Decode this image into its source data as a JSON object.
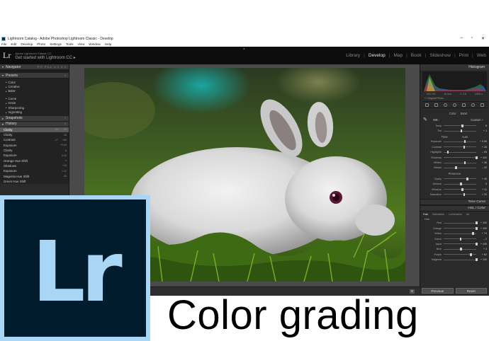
{
  "window": {
    "title": "Lightroom Catalog - Adobe Photoshop Lightroom Classic - Develop",
    "minimize": "–",
    "maximize": "▫",
    "close": "✕"
  },
  "menu": [
    "File",
    "Edit",
    "Develop",
    "Photo",
    "Settings",
    "Tools",
    "View",
    "Window",
    "Help"
  ],
  "identity": {
    "logo": "Lr",
    "subtitle": "Adobe Lightroom Classic CC",
    "main": "Get started with Lightroom CC ▸",
    "modules": [
      "Library",
      "Develop",
      "Map",
      "Book",
      "Slideshow",
      "Print",
      "Web"
    ],
    "active_module": "Develop"
  },
  "left_panel": {
    "navigator": {
      "label": "Navigator",
      "zoom": "FIT  FILL  1:1  3:1"
    },
    "presets": {
      "label": "Presets",
      "groups_a": [
        "Color",
        "Creative",
        "B&W"
      ],
      "groups_b": [
        "Curve",
        "Grain",
        "Sharpening",
        "Vignetting"
      ]
    },
    "snapshots": {
      "label": "Snapshots"
    },
    "history": {
      "label": "History",
      "rows": [
        {
          "name": "Clarity",
          "a": "-46",
          "b": "46",
          "selected": true
        },
        {
          "name": "Clarity",
          "a": "",
          "b": "28"
        },
        {
          "name": "Contrast",
          "a": "-17",
          "b": "+80"
        },
        {
          "name": "Exposure",
          "a": "",
          "b": "+0.60"
        },
        {
          "name": "Clarity",
          "a": "",
          "b": "8"
        },
        {
          "name": "Exposure",
          "a": "",
          "b": "0.43"
        },
        {
          "name": "Orange Hue Shift",
          "a": "",
          "b": "-1"
        },
        {
          "name": "Shadows",
          "a": "",
          "b": "+15"
        },
        {
          "name": "Exposure",
          "a": "",
          "b": "1.12"
        },
        {
          "name": "Magenta Hue Shift",
          "a": "",
          "b": "-40"
        },
        {
          "name": "Green Hue Shift",
          "a": "",
          "b": ""
        }
      ]
    }
  },
  "right_panel": {
    "histogram_label": "Histogram",
    "hist_info": [
      "ISO 100",
      "50 mm",
      "f / 2.8",
      "1/500 s"
    ],
    "original_photo": "Original Photo",
    "basic": {
      "treatment": "Color",
      "profile": "B&W"
    },
    "wb": {
      "label": "WB :",
      "value": "Custom ÷"
    },
    "tone": {
      "label": "Tone",
      "auto": "Auto"
    },
    "presence_label": "Presence",
    "tone_curve_label": "Tone Curve",
    "hsl_label": "HSL / Color",
    "hsl_tabs": [
      "Hue",
      "Saturation",
      "Luminance",
      "All"
    ],
    "hsl_sub": "Hue",
    "sliders": {
      "wb": [
        {
          "label": "Temp",
          "value": "6",
          "pos": 0.55
        },
        {
          "label": "Tint",
          "value": "+ 1",
          "pos": 0.52
        }
      ],
      "tone": [
        {
          "label": "Exposure",
          "value": "+ 0.95",
          "pos": 0.62
        },
        {
          "label": "Contrast",
          "value": "+ 28",
          "pos": 0.6
        },
        {
          "label": "Highlights",
          "value": "– 93",
          "pos": 0.1
        },
        {
          "label": "Shadows",
          "value": "+ 100",
          "pos": 0.98
        },
        {
          "label": "Whites",
          "value": "+ 26",
          "pos": 0.62
        },
        {
          "label": "Blacks",
          "value": "– 33",
          "pos": 0.35
        }
      ],
      "presence": [
        {
          "label": "Clarity",
          "value": "+ 40",
          "pos": 0.7
        },
        {
          "label": "Dehaze",
          "value": "0",
          "pos": 0.5
        },
        {
          "label": "Vibrance",
          "value": "+ 11",
          "pos": 0.55
        },
        {
          "label": "Saturation",
          "value": "+ 22",
          "pos": 0.6
        }
      ],
      "hsl": [
        {
          "label": "Red",
          "value": "+ 100",
          "pos": 0.98
        },
        {
          "label": "Orange",
          "value": "+ 100",
          "pos": 0.98
        },
        {
          "label": "Yellow",
          "value": "+ 74",
          "pos": 0.87
        },
        {
          "label": "Green",
          "value": "– 2",
          "pos": 0.49
        },
        {
          "label": "Aqua",
          "value": "+ 100",
          "pos": 0.98
        },
        {
          "label": "Blue",
          "value": "+ 3",
          "pos": 0.51
        },
        {
          "label": "Purple",
          "value": "+ 62",
          "pos": 0.81
        },
        {
          "label": "Magenta",
          "value": "+ 100",
          "pos": 0.98
        }
      ]
    },
    "buttons": {
      "previous": "Previous",
      "reset": "Reset"
    }
  },
  "overlay": {
    "logo_text": "Lr",
    "caption": "Color grading"
  },
  "colors": {
    "lr_logo_bg": "#001b2b",
    "lr_logo_accent": "#a8d6f4",
    "ui_dark": "#2a2a2a"
  }
}
